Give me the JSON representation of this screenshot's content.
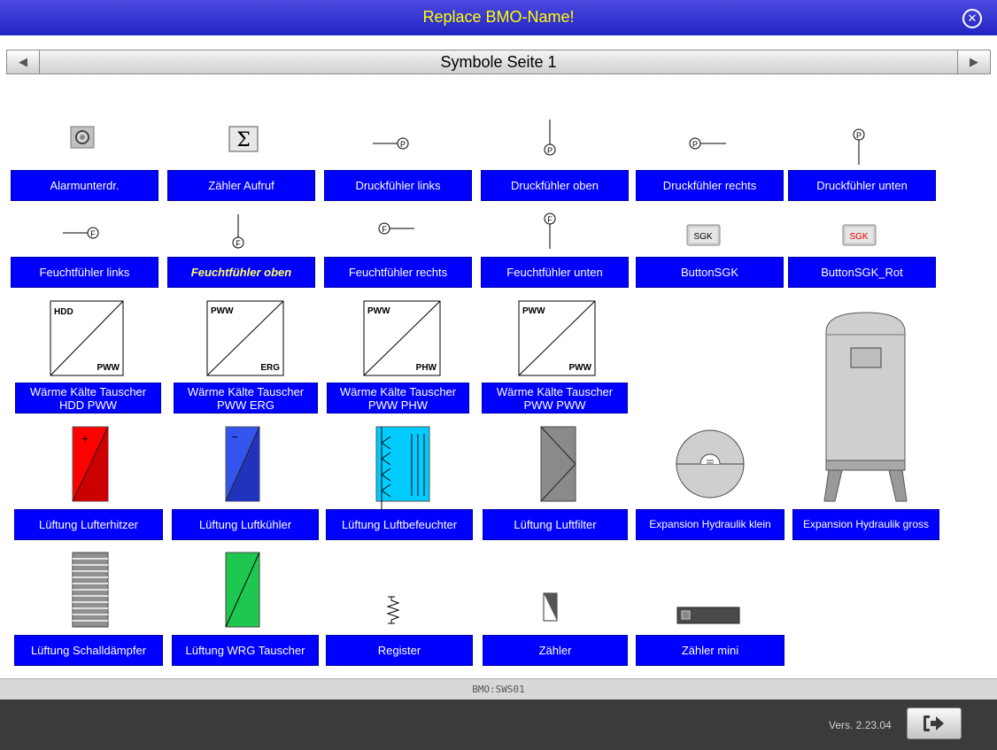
{
  "window": {
    "title": "Replace BMO-Name!",
    "close_icon": "close-circle-icon"
  },
  "nav": {
    "title": "Symbole Seite 1",
    "prev_icon": "arrow-left-icon",
    "next_icon": "arrow-right-icon"
  },
  "symbols": {
    "alarm": "Alarmunterdr.",
    "zaehler_aufruf": "Zähler Aufruf",
    "druck_links": "Druckfühler links",
    "druck_oben": "Druckfühler oben",
    "druck_rechts": "Druckfühler rechts",
    "druck_unten": "Druckfühler unten",
    "feucht_links": "Feuchtfühler links",
    "feucht_oben": "Feuchtfühler oben",
    "feucht_rechts": "Feuchtfühler rechts",
    "feucht_unten": "Feuchtfühler unten",
    "button_sgk": "ButtonSGK",
    "button_sgk_rot": "ButtonSGK_Rot",
    "wkt_hdd_pww": "Wärme Kälte Tauscher HDD PWW",
    "wkt_pww_erg": "Wärme Kälte Tauscher PWW ERG",
    "wkt_pww_phw": "Wärme Kälte Tauscher PWW PHW",
    "wkt_pww_pww": "Wärme Kälte Tauscher PWW PWW",
    "lufterhitzer": "Lüftung Lufterhitzer",
    "luftkuehler": "Lüftung Luftkühler",
    "luftbefeuchter": "Lüftung Luftbefeuchter",
    "luftfilter": "Lüftung Luftfilter",
    "exp_klein": "Expansion Hydraulik klein",
    "exp_gross": "Expansion Hydraulik gross",
    "schalldaempfer": "Lüftung Schalldämpfer",
    "wrg": "Lüftung WRG Tauscher",
    "register": "Register",
    "zaehler": "Zähler",
    "zaehler_mini": "Zähler mini"
  },
  "glyphs": {
    "sigma": "Σ",
    "p": "P",
    "f": "F",
    "sgk": "SGK",
    "hdd": "HDD",
    "pww": "PWW",
    "erg": "ERG",
    "phw": "PHW",
    "plus": "+",
    "minus": "−"
  },
  "status": {
    "text": "BMO:SWS01"
  },
  "footer": {
    "version": "Vers. 2.23.04",
    "exit_icon": "exit-icon"
  },
  "colors": {
    "accent_blue": "#0000ff",
    "title_text": "#ffff00",
    "heater_red": "#ff0000",
    "cooler_blue": "#2a3fe0",
    "humidifier_cyan": "#00ccff",
    "wrg_green": "#1ec850",
    "filter_gray": "#808080"
  }
}
